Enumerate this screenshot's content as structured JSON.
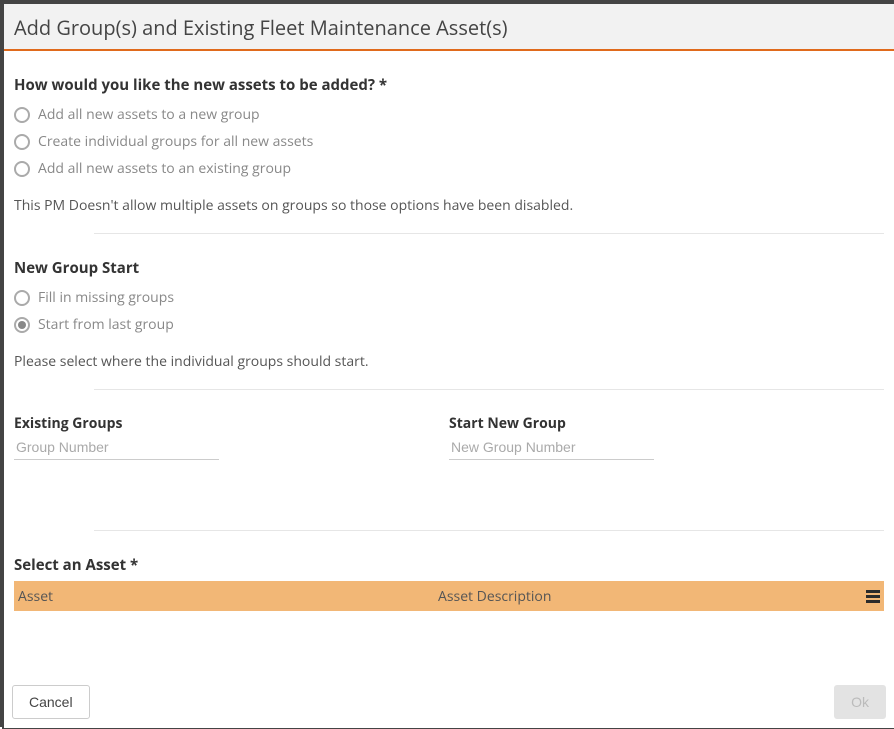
{
  "title": "Add Group(s) and Existing Fleet Maintenance Asset(s)",
  "section_add_mode": {
    "heading": "How would you like the new assets to be added? *",
    "options": [
      {
        "label": "Add all new assets to a new group",
        "selected": false
      },
      {
        "label": "Create individual groups for all new assets",
        "selected": false
      },
      {
        "label": "Add all new assets to an existing group",
        "selected": false
      }
    ],
    "helper": "This PM Doesn't allow multiple assets on groups so those options have been disabled."
  },
  "section_group_start": {
    "heading": "New Group Start",
    "options": [
      {
        "label": "Fill in missing groups",
        "selected": false
      },
      {
        "label": "Start from last group",
        "selected": true
      }
    ],
    "helper": "Please select where the individual groups should start."
  },
  "existing_groups": {
    "label": "Existing Groups",
    "placeholder": "Group Number",
    "value": ""
  },
  "start_new_group": {
    "label": "Start New Group",
    "placeholder": "New Group Number",
    "value": ""
  },
  "select_asset": {
    "heading": "Select an Asset *",
    "columns": {
      "asset": "Asset",
      "description": "Asset Description"
    }
  },
  "footer": {
    "cancel": "Cancel",
    "ok": "Ok"
  }
}
